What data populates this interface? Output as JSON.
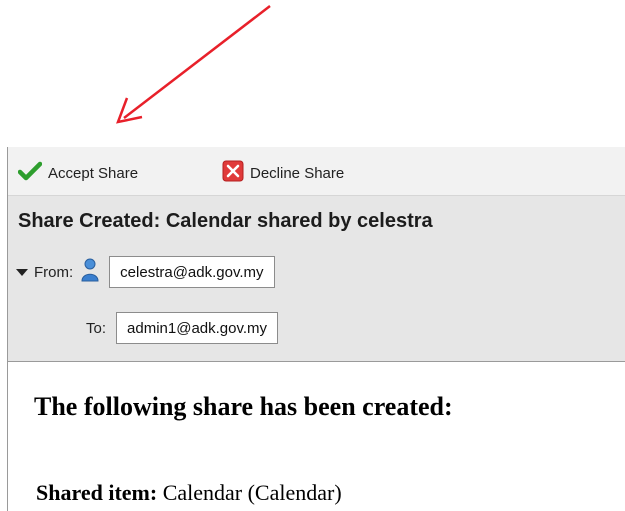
{
  "toolbar": {
    "accept_label": "Accept Share",
    "decline_label": "Decline Share",
    "accept_icon": "checkmark-icon",
    "decline_icon": "close-icon",
    "accept_color": "#2e9e2e",
    "decline_color": "#e03a3a"
  },
  "header": {
    "subject": "Share Created: Calendar shared by celestra",
    "from_label": "From:",
    "from_address": "celestra@adk.gov.my",
    "to_label": "To:",
    "to_address": "admin1@adk.gov.my"
  },
  "body": {
    "heading": "The following share has been created:",
    "shared_item_label": "Shared item:",
    "shared_item_value": "Calendar (Calendar)"
  },
  "annotation": {
    "type": "arrow",
    "color": "#e8202a"
  }
}
